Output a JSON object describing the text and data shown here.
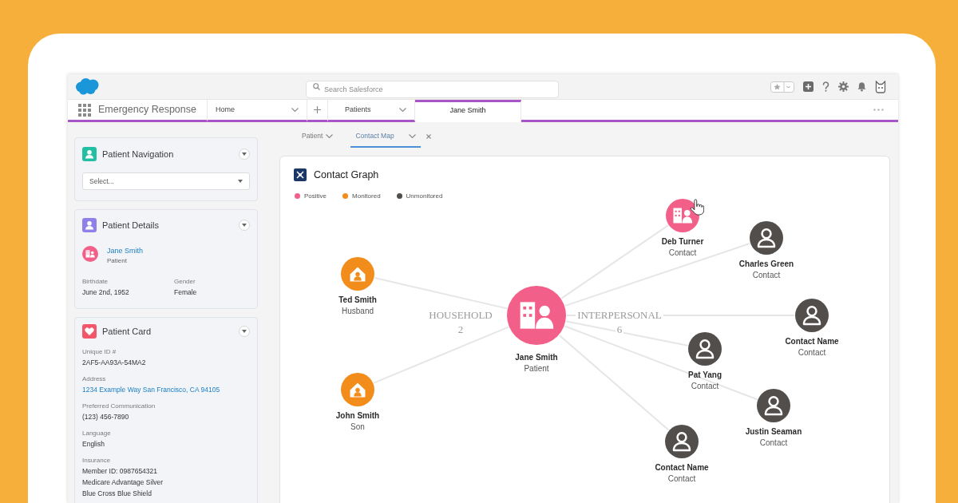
{
  "app_header": {
    "search": {
      "placeholder": "Search Salesforce"
    }
  },
  "nav_bar": {
    "app_name": "Emergency Response",
    "home_menu": {
      "label": "Home"
    },
    "tabs": [
      {
        "label": "Patients",
        "selected": false,
        "dropdown": true
      },
      {
        "label": "Jane Smith",
        "selected": true,
        "dropdown": false
      }
    ]
  },
  "sidebar": {
    "cards": [
      {
        "kind": "navigation",
        "title": "Patient Navigation",
        "select": {
          "placeholder": "Select..."
        }
      },
      {
        "kind": "details",
        "title": "Patient Details",
        "record": {
          "name": "Jane Smith",
          "type": "Patient"
        },
        "fields": [
          {
            "label": "Birthdate",
            "values": [
              "June 2nd, 1952"
            ],
            "link": false
          },
          {
            "label": "Gender",
            "values": [
              "Female"
            ],
            "link": false
          }
        ]
      },
      {
        "kind": "card",
        "title": "Patient Card",
        "fields": [
          {
            "label": "Unique ID #",
            "values": [
              "2AF5-AA93A-54MA2"
            ],
            "link": false
          },
          {
            "label": "Address",
            "values": [
              "1234 Example Way San Francisco, CA 94105"
            ],
            "link": true
          },
          {
            "label": "Preferred Communication",
            "values": [
              "(123) 456-7890"
            ],
            "link": false
          },
          {
            "label": "Language",
            "values": [
              "English"
            ],
            "link": false
          },
          {
            "label": "Insurance",
            "values": [
              "Member ID: 0987654321",
              "Medicare Advantage Silver",
              "Blue Cross Blue Shield"
            ],
            "link": false
          }
        ]
      }
    ]
  },
  "subtabs": [
    {
      "label": "Patient",
      "selected": false,
      "closable": false
    },
    {
      "label": "Contact Map",
      "selected": true,
      "closable": true
    }
  ],
  "graph": {
    "title": "Contact Graph",
    "legend": [
      {
        "kind": "positive",
        "label": "Positive",
        "color": "#f2608a"
      },
      {
        "kind": "monitored",
        "label": "Monitored",
        "color": "#f28c1a"
      },
      {
        "kind": "unmonitored",
        "label": "Unmonitored",
        "color": "#524e4c"
      }
    ],
    "center": {
      "name": "Jane Smith",
      "role": "Patient",
      "kind": "positive",
      "hovered": false
    },
    "groups": [
      {
        "label": "HOUSEHOLD",
        "count": "2",
        "nodes": [
          {
            "name": "Ted Smith",
            "role": "Husband",
            "kind": "monitored",
            "hovered": false
          },
          {
            "name": "John Smith",
            "role": "Son",
            "kind": "monitored",
            "hovered": false
          }
        ]
      },
      {
        "label": "INTERPERSONAL",
        "count": "6",
        "nodes": [
          {
            "name": "Deb Turner",
            "role": "Contact",
            "kind": "positive",
            "hovered": true
          },
          {
            "name": "Charles Green",
            "role": "Contact",
            "kind": "unmonitored",
            "hovered": false
          },
          {
            "name": "Contact Name",
            "role": "Contact",
            "kind": "unmonitored",
            "hovered": false
          },
          {
            "name": "Pat Yang",
            "role": "Contact",
            "kind": "unmonitored",
            "hovered": false
          },
          {
            "name": "Justin Seaman",
            "role": "Contact",
            "kind": "unmonitored",
            "hovered": false
          },
          {
            "name": "Contact Name",
            "role": "Contact",
            "kind": "unmonitored",
            "hovered": false
          }
        ]
      }
    ]
  }
}
